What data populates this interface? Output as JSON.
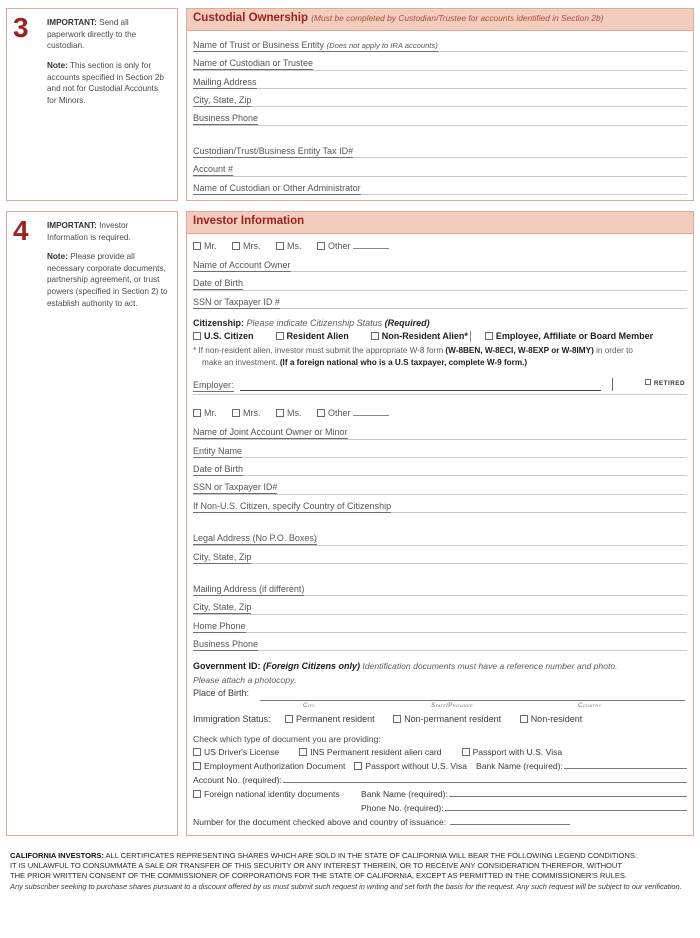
{
  "section3": {
    "number": "3",
    "notes": [
      {
        "bold": "IMPORTANT:",
        "text": " Send all paperwork directly to the custodian."
      },
      {
        "bold": "Note:",
        "text": " This section is only for accounts specified in Section 2b and not for Custodial Accounts for Minors."
      }
    ],
    "panel": {
      "title": "Custodial Ownership",
      "subtitle": "(Must be completed by Custodian/Trustee for accounts identified in Section 2b)",
      "fields": [
        {
          "label": "Name of Trust or Business Entity",
          "italic": "(Does not apply to IRA accounts)"
        },
        {
          "label": "Name of Custodian or Trustee",
          "italic": ""
        },
        {
          "label": "Mailing Address",
          "italic": ""
        },
        {
          "label": "City, State, Zip",
          "italic": ""
        },
        {
          "label": "Business Phone",
          "italic": ""
        }
      ],
      "fields2": [
        {
          "label": "Custodian/Trust/Business Entity Tax ID#",
          "italic": ""
        },
        {
          "label": "Account #",
          "italic": ""
        },
        {
          "label": "Name of Custodian or Other Administrator",
          "italic": ""
        }
      ]
    }
  },
  "section4": {
    "number": "4",
    "notes": [
      {
        "bold": "IMPORTANT:",
        "text": " Investor Information is required."
      },
      {
        "bold": "Note:",
        "text": " Please provide all necessary corporate documents, partnership agreement, or trust powers (specified in Section 2) to establish authority to act."
      }
    ],
    "panel": {
      "title": "Investor Information",
      "subtitle": "",
      "titles_owner": {
        "mr": "Mr.",
        "mrs": "Mrs.",
        "ms": "Ms.",
        "other": "Other"
      },
      "owner_fields": [
        {
          "label": "Name of Account Owner",
          "italic": ""
        },
        {
          "label": "Date of Birth",
          "italic": ""
        },
        {
          "label": "SSN or Taxpayer ID #",
          "italic": ""
        }
      ],
      "citizenship": {
        "label": "Citizenship:",
        "instruction": "Please indicate Citizenship Status",
        "required": "(Required)",
        "options": [
          "U.S. Citizen",
          "Resident Alien",
          "Non-Resident Alien*"
        ],
        "employee_option": "Employee, Affiliate or Board Member",
        "note_line1_a": "* If non-resident alien, investor must submit the appropriate W-8 form ",
        "note_line1_b": "(W-8BEN, W-8ECI, W-8EXP or W-8IMY)",
        "note_line1_c": " in order to",
        "note_line2_a": "make an investment. ",
        "note_line2_b": "(If a foreign national who is a U.S taxpayer, complete W-9 form.)"
      },
      "employer": {
        "label": "Employer:",
        "retired": "RETIRED"
      },
      "joint_fields": [
        {
          "label": "Name of Joint Account Owner or Minor",
          "italic": ""
        },
        {
          "label": "Entity Name",
          "italic": ""
        },
        {
          "label": "Date of Birth",
          "italic": ""
        },
        {
          "label": "SSN or Taxpayer ID#",
          "italic": ""
        },
        {
          "label": "If Non-U.S. Citizen, specify Country of Citizenship",
          "italic": ""
        }
      ],
      "legal_fields": [
        {
          "label": "Legal Address (No P.O. Boxes)",
          "italic": ""
        },
        {
          "label": "City, State, Zip",
          "italic": ""
        }
      ],
      "mailing_fields": [
        {
          "label": "Mailing Address (if different)",
          "italic": ""
        },
        {
          "label": "City, State, Zip",
          "italic": ""
        },
        {
          "label": "Home Phone",
          "italic": ""
        },
        {
          "label": "Business Phone",
          "italic": ""
        }
      ],
      "government_id": {
        "label": "Government ID:",
        "foreign": "(Foreign Citizens only)",
        "desc": " Identification documents must have a reference number and photo.",
        "desc2": "Please attach a photocopy.",
        "place_of_birth": "Place of Birth:",
        "sub_city": "City",
        "sub_state": "State/Province",
        "sub_country": "Country",
        "immigration_label": "Immigration Status:",
        "immigration_options": [
          "Permanent resident",
          "Non-permanent resident",
          "Non-resident"
        ]
      },
      "documents": {
        "lead": "Check which type of document you are providing:",
        "row1": [
          "US Driver's License",
          "INS Permanent resident alien card",
          "Passport with U.S. Visa"
        ],
        "row2": [
          "Employment Authorization Document",
          "Passport without U.S. Visa"
        ],
        "bank_name_label": "Bank Name (required):",
        "account_no_label": "Account No. (required):",
        "foreign_docs": "Foreign national identity documents",
        "bank_name_label2": "Bank Name (required):",
        "phone_no_label": "Phone No. (required):",
        "number_label": "Number for the document checked above and country of issuance:"
      }
    }
  },
  "california": {
    "heading": "CALIFORNIA INVESTORS:",
    "line1": " ALL CERTIFICATES REPRESENTING SHARES WHICH ARE SOLD IN THE STATE OF CALIFORNIA WILL BEAR THE FOLLOWING LEGEND CONDITIONS:",
    "line2": "IT IS UNLAWFUL TO CONSUMMATE A SALE OR TRANSFER OF THIS SECURITY OR ANY INTEREST THEREIN, OR TO RECEIVE ANY CONSIDERATION THEREFOR, WITHOUT",
    "line3": "THE PRIOR WRITTEN CONSENT OF THE COMMISSIONER OF CORPORATIONS FOR THE STATE OF CALIFORNIA, EXCEPT AS PERMITTED IN THE COMMISSIONER'S RULES.",
    "italic": "Any subscriber seeking to purchase shares pursuant to a discount offered by us must submit such request in writing and set forth the basis for the request. Any such request will be subject to our verification."
  },
  "colors": {
    "header_bg": "#f2cdbd",
    "border": "#e0a899",
    "title_red": "#9e2020",
    "number_red": "#a02121"
  }
}
